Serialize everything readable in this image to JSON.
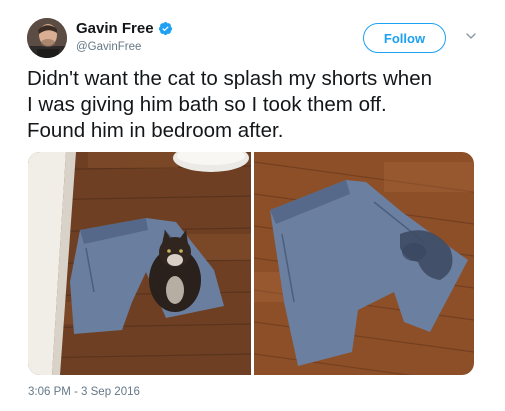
{
  "author": {
    "name": "Gavin Free",
    "handle": "@GavinFree",
    "verified": true,
    "avatar_icon": "avatar-photo"
  },
  "actions": {
    "follow_label": "Follow",
    "more_icon": "chevron-down-icon"
  },
  "tweet": {
    "lines": [
      "Didn't want the cat to splash my shorts when",
      "I was giving him bath so I took them off.",
      "Found him in bedroom after."
    ],
    "timestamp": "3:06 PM - 3 Sep 2016"
  },
  "media": {
    "photos": [
      {
        "name": "shorts-with-cat-photo"
      },
      {
        "name": "wet-shorts-photo"
      }
    ]
  },
  "colors": {
    "accent": "#1da1f2",
    "text": "#14171a",
    "secondary": "#657786"
  }
}
